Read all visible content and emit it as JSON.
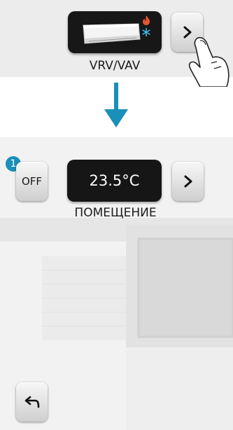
{
  "top_panel": {
    "device_label": "VRV/VAV",
    "device_icon": "air-conditioner-icon",
    "mode_icons": [
      "flame-icon",
      "snowflake-icon"
    ],
    "next_icon": "chevron-right-icon"
  },
  "transition_icon": "arrow-down-icon",
  "screen": {
    "badge": "1",
    "off_label": "OFF",
    "temperature": "23.5°C",
    "room_label": "ПОМЕЩЕНИЕ",
    "next_icon": "chevron-right-icon",
    "back_icon": "back-arrow-icon"
  },
  "colors": {
    "accent": "#1a8fb9",
    "tile": "#171717",
    "flame": "#e4572e",
    "snowflake": "#3fb7e5"
  }
}
